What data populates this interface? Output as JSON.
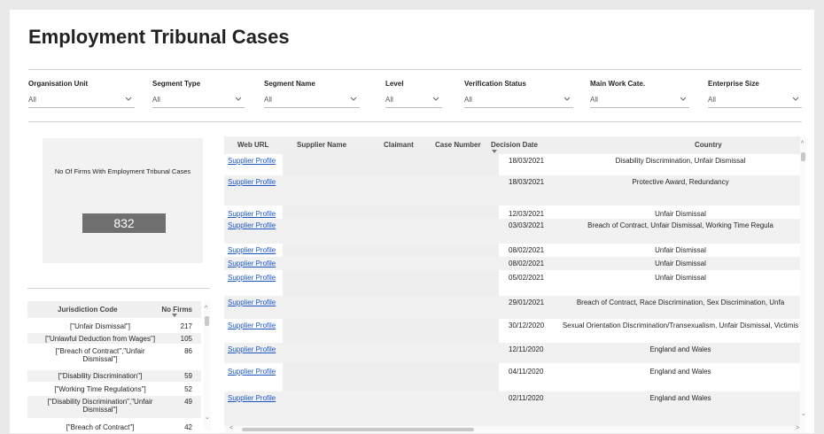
{
  "page": {
    "title": "Employment Tribunal Cases"
  },
  "filters": [
    {
      "label": "Organisation Unit",
      "value": "All"
    },
    {
      "label": "Segment Type",
      "value": "All"
    },
    {
      "label": "Segment Name",
      "value": "All"
    },
    {
      "label": "Level",
      "value": "All"
    },
    {
      "label": "Verification Status",
      "value": "All"
    },
    {
      "label": "Main Work Cate.",
      "value": "All"
    },
    {
      "label": "Enterprise Size",
      "value": "All"
    }
  ],
  "card": {
    "title": "No Of Firms With Employment Tribunal Cases",
    "value": "832"
  },
  "jurisdiction": {
    "headers": [
      "Jurisdiction Code",
      "No Firms"
    ],
    "rows": [
      {
        "code": "[\"Unfair Dismissal\"]",
        "count": "217"
      },
      {
        "code": "[\"Unlawful Deduction from Wages\"]",
        "count": "105"
      },
      {
        "code": "[\"Breach of Contract\",\"Unfair Dismissal\"]",
        "count": "86"
      },
      {
        "code": "[\"Disability Discrimination\"]",
        "count": "59"
      },
      {
        "code": "[\"Working Time Regulations\"]",
        "count": "52"
      },
      {
        "code": "[\"Disability Discrimination\",\"Unfair Dismissal\"]",
        "count": "49"
      },
      {
        "code": "[\"Breach of Contract\"]",
        "count": "42"
      }
    ]
  },
  "cases": {
    "headers": [
      "Web URL",
      "Supplier Name",
      "Claimant",
      "Case Number",
      "Decision Date",
      "Country"
    ],
    "rows": [
      {
        "url": "Supplier Profile",
        "date": "18/03/2021",
        "country": "Disability Discrimination, Unfair Dismissal"
      },
      {
        "url": "Supplier Profile",
        "date": "18/03/2021",
        "country": "Protective Award, Redundancy"
      },
      {
        "url": "Supplier Profile",
        "date": "12/03/2021",
        "country": "Unfair Dismissal"
      },
      {
        "url": "Supplier Profile",
        "date": "03/03/2021",
        "country": "Breach of Contract, Unfair Dismissal, Working Time Regula"
      },
      {
        "url": "Supplier Profile",
        "date": "08/02/2021",
        "country": "Unfair Dismissal"
      },
      {
        "url": "Supplier Profile",
        "date": "08/02/2021",
        "country": "Unfair Dismissal"
      },
      {
        "url": "Supplier Profile",
        "date": "05/02/2021",
        "country": "Unfair Dismissal"
      },
      {
        "url": "Supplier Profile",
        "date": "29/01/2021",
        "country": "Breach of Contract, Race Discrimination, Sex Discrimination, Unfa"
      },
      {
        "url": "Supplier Profile",
        "date": "30/12/2020",
        "country": "Sexual Orientation Discrimination/Transexualism, Unfair Dismissal, Victimis"
      },
      {
        "url": "Supplier Profile",
        "date": "12/11/2020",
        "country": "England and Wales"
      },
      {
        "url": "Supplier Profile",
        "date": "04/11/2020",
        "country": "England and Wales"
      },
      {
        "url": "Supplier Profile",
        "date": "02/11/2020",
        "country": "England and Wales"
      }
    ]
  },
  "icons": {
    "dropdown": "chevron-down-icon",
    "sort": "sort-desc-icon"
  }
}
